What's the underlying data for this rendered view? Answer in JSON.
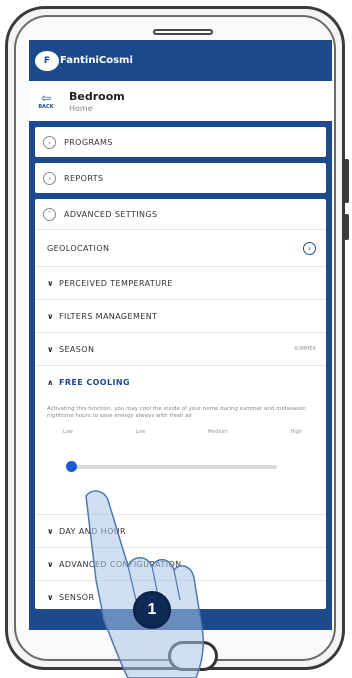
{
  "app": {
    "logo_mark": "F",
    "brand": "FantiniCosmi"
  },
  "header": {
    "back_label": "BACK",
    "title": "Bedroom",
    "subtitle": "Home"
  },
  "menu": {
    "programs": "PROGRAMS",
    "reports": "REPORTS",
    "advanced": "ADVANCED SETTINGS"
  },
  "advanced_items": {
    "geolocation": "GEOLOCATION",
    "perceived_temperature": "PERCEIVED TEMPERATURE",
    "filters_management": "FILTERS MANAGEMENT",
    "season": "SEASON",
    "season_value": "SUMMER",
    "free_cooling": "FREE COOLING",
    "free_cooling_desc": "Activating this function, you may cool the inside of your home during summer and midseason nighttime hours to save energy always with fresh air",
    "levels": [
      "Low",
      "Low",
      "Medium",
      "High"
    ],
    "slider_fraction": 0.0,
    "day_and_hour": "DAY AND HOUR",
    "advanced_configuration": "ADVANCED CONFIGURATION",
    "sensor": "SENSOR"
  },
  "step_badge": "1",
  "colors": {
    "brand_blue": "#1c4a8c",
    "accent_blue": "#1a5bd0"
  }
}
